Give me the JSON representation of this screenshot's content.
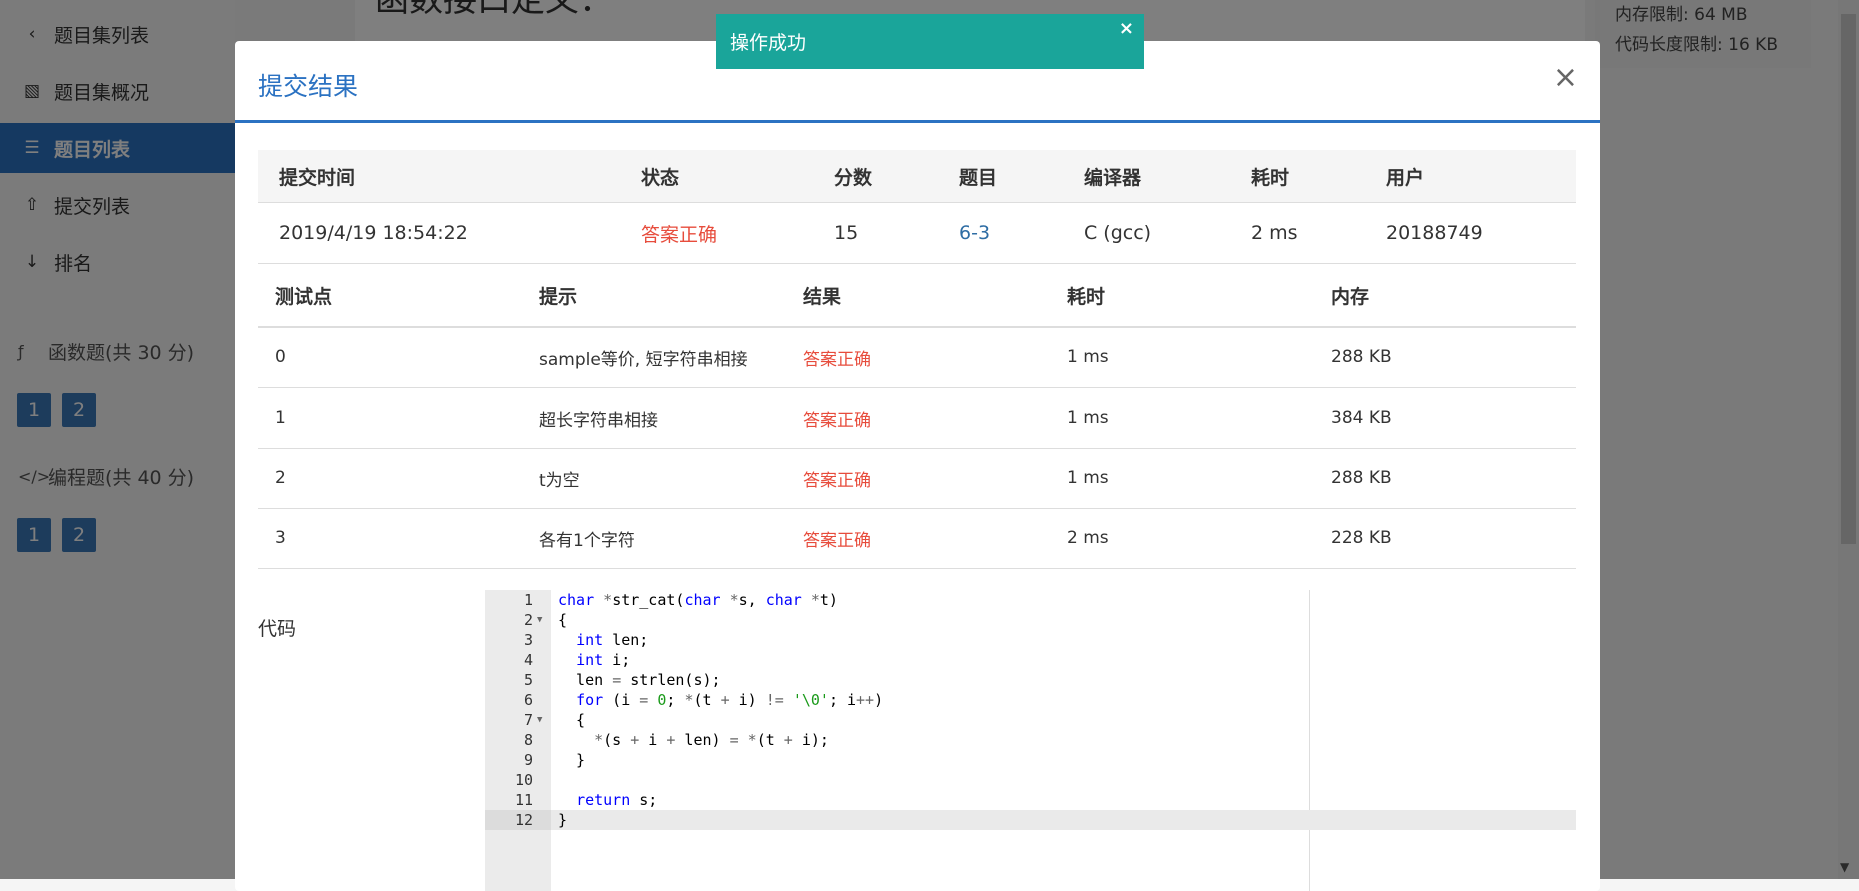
{
  "sidebar": {
    "items": [
      {
        "label": "题目集列表",
        "icon": "chevron-left-icon"
      },
      {
        "label": "题目集概况",
        "icon": "book-icon"
      },
      {
        "label": "题目列表",
        "icon": "list-icon"
      },
      {
        "label": "提交列表",
        "icon": "upload-icon"
      },
      {
        "label": "排名",
        "icon": "sort-numeric-icon"
      }
    ],
    "sections": [
      {
        "title": "函数题(共 30 分)",
        "icon": "function-icon",
        "buttons": [
          "1",
          "2"
        ]
      },
      {
        "title": "编程题(共 40 分)",
        "icon": "code-icon",
        "buttons": [
          "1",
          "2"
        ]
      }
    ]
  },
  "main": {
    "title": "函数接口定义："
  },
  "right_info": {
    "memory_limit": "内存限制: 64 MB",
    "code_limit": "代码长度限制: 16 KB"
  },
  "toast": {
    "message": "操作成功",
    "close": "×"
  },
  "modal": {
    "title": "提交结果",
    "close": "×",
    "summary_headers": [
      "提交时间",
      "状态",
      "分数",
      "题目",
      "编译器",
      "耗时",
      "用户"
    ],
    "summary": {
      "time": "2019/4/19 18:54:22",
      "status": "答案正确",
      "score": "15",
      "problem": "6-3",
      "compiler": "C (gcc)",
      "duration": "2 ms",
      "user": "20188749"
    },
    "testpoint_headers": [
      "测试点",
      "提示",
      "结果",
      "耗时",
      "内存"
    ],
    "testpoints": [
      {
        "id": "0",
        "hint": "sample等价, 短字符串相接",
        "result": "答案正确",
        "time": "1 ms",
        "memory": "288 KB"
      },
      {
        "id": "1",
        "hint": "超长字符串相接",
        "result": "答案正确",
        "time": "1 ms",
        "memory": "384 KB"
      },
      {
        "id": "2",
        "hint": "t为空",
        "result": "答案正确",
        "time": "1 ms",
        "memory": "288 KB"
      },
      {
        "id": "3",
        "hint": "各有1个字符",
        "result": "答案正确",
        "time": "2 ms",
        "memory": "228 KB"
      }
    ],
    "code_label": "代码",
    "code_lines": [
      "char *str_cat(char *s, char *t)",
      "{",
      "  int len;",
      "  int i;",
      "  len = strlen(s);",
      "  for (i = 0; *(t + i) != '\\0'; i++)",
      "  {",
      "    *(s + i + len) = *(t + i);",
      "  }",
      "",
      "  return s;",
      "}"
    ]
  },
  "colors": {
    "primary": "#2b72c2",
    "success_text": "#e74c3c",
    "toast_bg": "#1aa59a"
  }
}
